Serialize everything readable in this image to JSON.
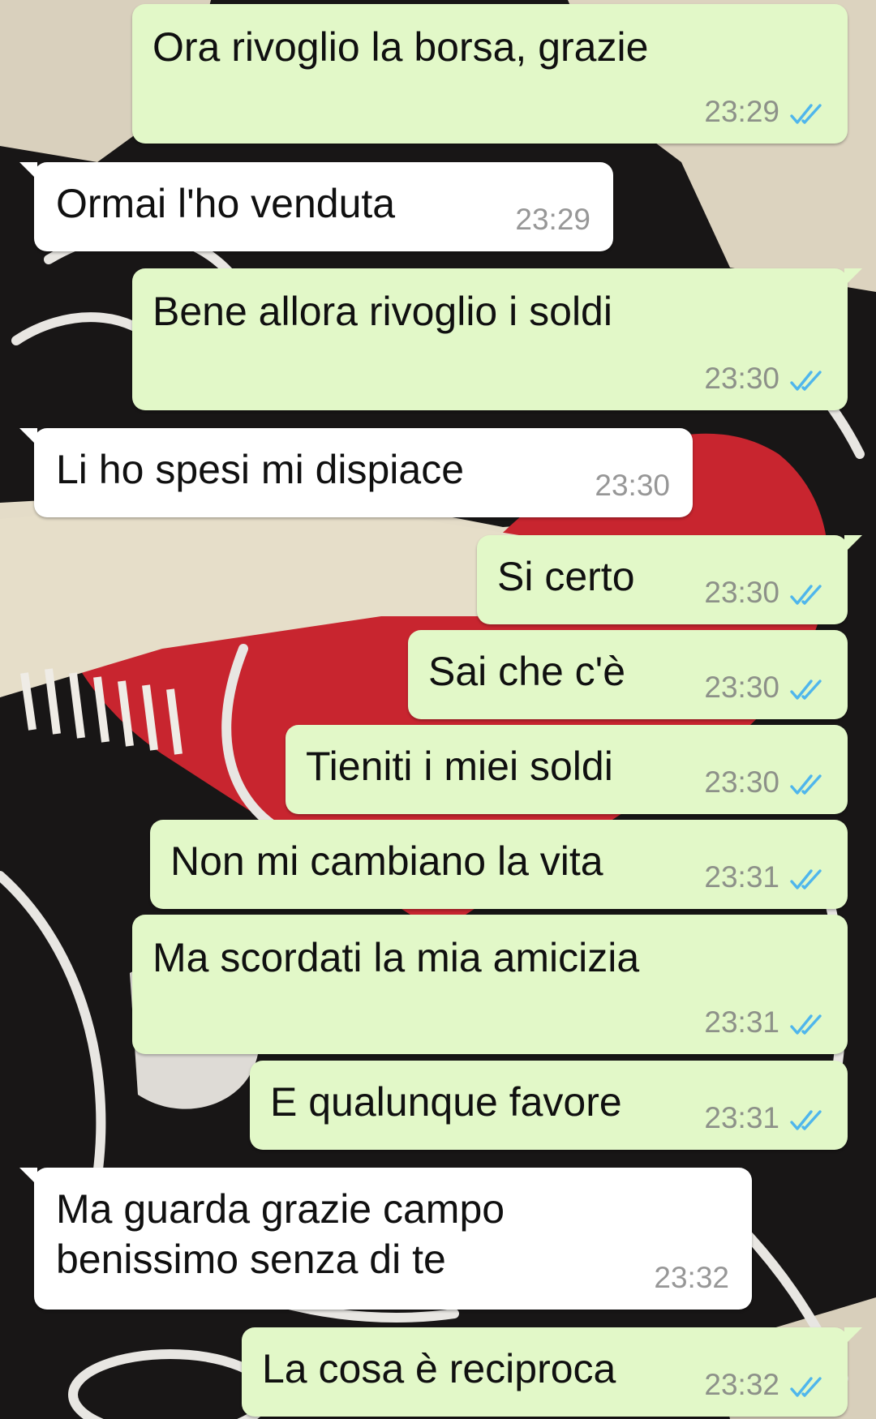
{
  "messages": [
    {
      "direction": "out",
      "text": "Ora rivoglio la borsa, grazie",
      "time": "23:29",
      "status_icon": "double-check-read-icon"
    },
    {
      "direction": "in",
      "text": "Ormai l'ho venduta",
      "time": "23:29"
    },
    {
      "direction": "out",
      "text": "Bene allora rivoglio i soldi",
      "time": "23:30",
      "status_icon": "double-check-read-icon"
    },
    {
      "direction": "in",
      "text": "Li ho spesi mi dispiace",
      "time": "23:30"
    },
    {
      "direction": "out",
      "text": "Si certo",
      "time": "23:30",
      "status_icon": "double-check-read-icon"
    },
    {
      "direction": "out",
      "text": "Sai che c'è",
      "time": "23:30",
      "status_icon": "double-check-read-icon"
    },
    {
      "direction": "out",
      "text": "Tieniti i miei soldi",
      "time": "23:30",
      "status_icon": "double-check-read-icon"
    },
    {
      "direction": "out",
      "text": "Non mi cambiano la vita",
      "time": "23:31",
      "status_icon": "double-check-read-icon"
    },
    {
      "direction": "out",
      "text": "Ma scordati la mia amicizia",
      "time": "23:31",
      "status_icon": "double-check-read-icon"
    },
    {
      "direction": "out",
      "text": "E qualunque favore",
      "time": "23:31",
      "status_icon": "double-check-read-icon"
    },
    {
      "direction": "in",
      "text": "Ma guarda grazie campo\nbenissimo senza di te",
      "time": "23:32"
    },
    {
      "direction": "out",
      "text": "La cosa è reciproca",
      "time": "23:32",
      "status_icon": "double-check-read-icon"
    }
  ],
  "colors": {
    "outgoing_bubble": "#e2f8c8",
    "incoming_bubble": "#ffffff",
    "read_ticks": "#4fb6ec",
    "timestamp": "#8d9189"
  }
}
